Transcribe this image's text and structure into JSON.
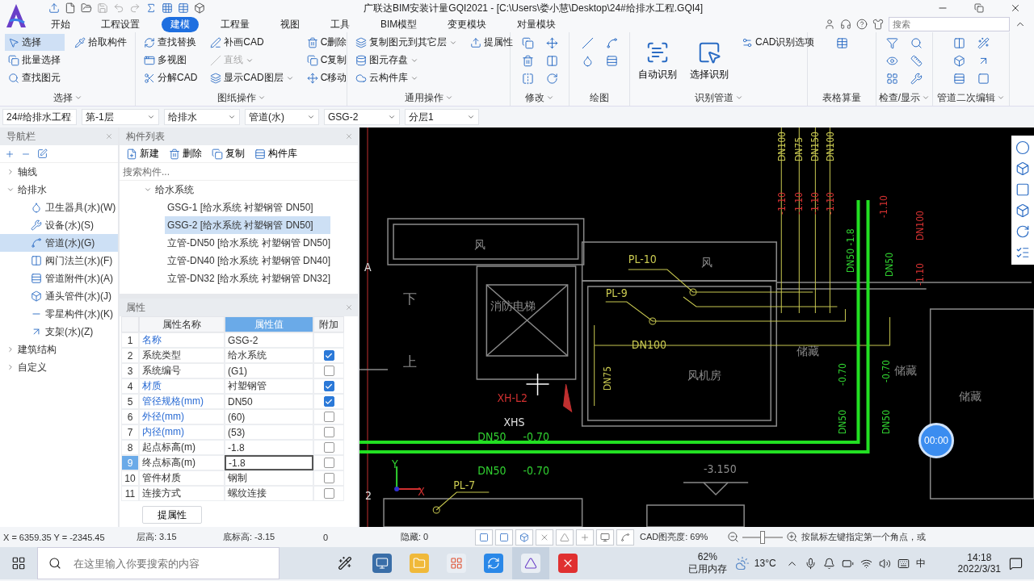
{
  "app": {
    "title": "广联达BIM安装计量GQI2021 - [C:\\Users\\娄小慧\\Desktop\\24#给排水工程.GQI4]"
  },
  "menu_tabs": [
    {
      "label": "开始",
      "selected": false
    },
    {
      "label": "工程设置",
      "selected": false
    },
    {
      "label": "建模",
      "selected": true
    },
    {
      "label": "工程量",
      "selected": false
    },
    {
      "label": "视图",
      "selected": false
    },
    {
      "label": "工具",
      "selected": false
    },
    {
      "label": "BIM模型",
      "selected": false
    },
    {
      "label": "变更模块",
      "selected": false
    },
    {
      "label": "对量模块",
      "selected": false
    }
  ],
  "search": {
    "placeholder": "搜索"
  },
  "ribbon_groups": [
    {
      "title": "选择",
      "dropdown": true,
      "kind": "buttons",
      "items": [
        {
          "label": "选择",
          "kind": "small",
          "active": true
        },
        {
          "label": "批量选择",
          "kind": "small",
          "active": false
        },
        {
          "label": "查找图元",
          "kind": "small",
          "active": false
        },
        {
          "label": "拾取构件",
          "kind": "small",
          "active": false
        }
      ]
    },
    {
      "title": "图纸操作",
      "dropdown": true,
      "kind": "buttons",
      "items": [
        {
          "label": "查找替换",
          "kind": "small",
          "disabled": false
        },
        {
          "label": "多视图",
          "kind": "small",
          "disabled": false
        },
        {
          "label": "分解CAD",
          "kind": "small",
          "disabled": false
        },
        {
          "label": "补画CAD",
          "kind": "small",
          "disabled": false
        },
        {
          "label": "直线",
          "kind": "small",
          "disabled": true,
          "dropdown": true
        },
        {
          "label": "显示CAD图层",
          "kind": "small",
          "disabled": false,
          "dropdown": true
        },
        {
          "label": "C删除",
          "kind": "small",
          "disabled": false
        },
        {
          "label": "C复制",
          "kind": "small",
          "disabled": false
        },
        {
          "label": "C移动",
          "kind": "small",
          "disabled": false
        }
      ]
    },
    {
      "title": "通用操作",
      "dropdown": true,
      "kind": "buttons",
      "items": [
        {
          "label": "复制图元到其它层",
          "kind": "small",
          "dropdown": true
        },
        {
          "label": "图元存盘",
          "kind": "small",
          "dropdown": true
        },
        {
          "label": "云构件库",
          "kind": "small",
          "dropdown": true
        },
        {
          "label": "提属性",
          "kind": "small"
        }
      ]
    },
    {
      "title": "修改",
      "dropdown": true,
      "kind": "icons"
    },
    {
      "title": "绘图",
      "dropdown": false,
      "kind": "icons"
    },
    {
      "title": "识别管道",
      "dropdown": true,
      "kind": "buttons",
      "items": [
        {
          "label": "自动识别",
          "kind": "large"
        },
        {
          "label": "选择识别",
          "kind": "large"
        },
        {
          "label": "CAD识别选项",
          "kind": "small"
        }
      ]
    },
    {
      "title": "表格算量",
      "dropdown": false,
      "kind": "icons"
    },
    {
      "title": "检查/显示",
      "dropdown": true,
      "kind": "icons"
    },
    {
      "title": "管道二次编辑",
      "dropdown": true,
      "kind": "icons"
    }
  ],
  "selectors": [
    "24#给排水工程",
    "第-1层",
    "给排水",
    "管道(水)",
    "GSG-2",
    "分层1"
  ],
  "navigator": {
    "title": "导航栏",
    "tree": [
      {
        "label": "轴线",
        "expanded": false
      },
      {
        "label": "给排水",
        "expanded": true,
        "children": [
          {
            "label": "卫生器具(水)(W)",
            "selected": false
          },
          {
            "label": "设备(水)(S)",
            "selected": false
          },
          {
            "label": "管道(水)(G)",
            "selected": true
          },
          {
            "label": "阀门法兰(水)(F)",
            "selected": false
          },
          {
            "label": "管道附件(水)(A)",
            "selected": false
          },
          {
            "label": "通头管件(水)(J)",
            "selected": false
          },
          {
            "label": "零星构件(水)(K)",
            "selected": false
          },
          {
            "label": "支架(水)(Z)",
            "selected": false
          }
        ]
      },
      {
        "label": "建筑结构",
        "expanded": false
      },
      {
        "label": "自定义",
        "expanded": false
      }
    ]
  },
  "component_list": {
    "title": "构件列表",
    "toolbar": [
      "新建",
      "删除",
      "复制",
      "构件库"
    ],
    "search_placeholder": "搜索构件...",
    "group": {
      "label": "给水系统",
      "expanded": true,
      "children": [
        {
          "label": "GSG-1 [给水系统 衬塑钢管 DN50]",
          "selected": false
        },
        {
          "label": "GSG-2 [给水系统 衬塑钢管 DN50]",
          "selected": true
        },
        {
          "label": "立管-DN50 [给水系统 衬塑钢管 DN50]",
          "selected": false
        },
        {
          "label": "立管-DN40 [给水系统 衬塑钢管 DN40]",
          "selected": false
        },
        {
          "label": "立管-DN32 [给水系统 衬塑钢管 DN32]",
          "selected": false
        }
      ]
    }
  },
  "properties": {
    "title": "属性",
    "columns": [
      "属性名称",
      "属性值",
      "附加"
    ],
    "rows": [
      {
        "index": "1",
        "name": "名称",
        "value": "GSG-2",
        "public": true,
        "selected": false
      },
      {
        "index": "2",
        "name": "系统类型",
        "value": "给水系统",
        "public": false,
        "selected": false,
        "checked": true
      },
      {
        "index": "3",
        "name": "系统编号",
        "value": "(G1)",
        "public": false,
        "selected": false,
        "checked": false
      },
      {
        "index": "4",
        "name": "材质",
        "value": "衬塑钢管",
        "public": true,
        "selected": false,
        "checked": true
      },
      {
        "index": "5",
        "name": "管径规格(mm)",
        "value": "DN50",
        "public": true,
        "selected": false,
        "checked": true
      },
      {
        "index": "6",
        "name": "外径(mm)",
        "value": "(60)",
        "public": true,
        "selected": false,
        "checked": false
      },
      {
        "index": "7",
        "name": "内径(mm)",
        "value": "(53)",
        "public": true,
        "selected": false,
        "checked": false
      },
      {
        "index": "8",
        "name": "起点标高(m)",
        "value": "-1.8",
        "public": false,
        "selected": false,
        "checked": false
      },
      {
        "index": "9",
        "name": "终点标高(m)",
        "value": "-1.8",
        "public": false,
        "selected": true,
        "checked": false
      },
      {
        "index": "10",
        "name": "管件材质",
        "value": "钢制",
        "public": false,
        "selected": false,
        "checked": false
      },
      {
        "index": "11",
        "name": "连接方式",
        "value": "螺纹连接",
        "public": false,
        "selected": false,
        "checked": false
      }
    ],
    "button": "提属性"
  },
  "cad_labels": [
    {
      "text": "DN100",
      "color": "#c8c850"
    },
    {
      "text": "DN75",
      "color": "#c8c850"
    },
    {
      "text": "DN150",
      "color": "#c8c850"
    },
    {
      "text": "DN100",
      "color": "#c8c850"
    },
    {
      "text": "-1.10",
      "color": "#d03030"
    },
    {
      "text": "-1.10",
      "color": "#d03030"
    },
    {
      "text": "-1.10",
      "color": "#d03030"
    },
    {
      "text": "-1.10",
      "color": "#d03030"
    },
    {
      "text": "风",
      "color": "#8a8a8a"
    },
    {
      "text": "PL-10",
      "color": "#c8c850"
    },
    {
      "text": "风",
      "color": "#8a8a8a"
    },
    {
      "text": "PL-9",
      "color": "#c8c850"
    },
    {
      "text": "DN50 -1.8",
      "color": "#30d030"
    },
    {
      "text": "DN50",
      "color": "#30d030"
    },
    {
      "text": "-1.10",
      "color": "#d03030"
    },
    {
      "text": "DN100",
      "color": "#d03030"
    },
    {
      "text": "-1.10",
      "color": "#d03030"
    },
    {
      "text": "消防电梯",
      "color": "#8a8a8a"
    },
    {
      "text": "下",
      "color": "#8a8a8a"
    },
    {
      "text": "上",
      "color": "#8a8a8a"
    },
    {
      "text": "DN100",
      "color": "#c8c850"
    },
    {
      "text": "DN75",
      "color": "#c8c850"
    },
    {
      "text": "风机房",
      "color": "#8a8a8a"
    },
    {
      "text": "储藏",
      "color": "#8a8a8a"
    },
    {
      "text": "-0.70",
      "color": "#30d030"
    },
    {
      "text": "-0.70",
      "color": "#30d030"
    },
    {
      "text": "储藏",
      "color": "#8a8a8a"
    },
    {
      "text": "储藏",
      "color": "#8a8a8a"
    },
    {
      "text": "DN50",
      "color": "#30d030"
    },
    {
      "text": "DN50",
      "color": "#30d030"
    },
    {
      "text": "XH-L2",
      "color": "#d03030"
    },
    {
      "text": "XHS",
      "color": "#e0e0e0"
    },
    {
      "text": "DN50",
      "color": "#30d030"
    },
    {
      "text": "-0.70",
      "color": "#30d030"
    },
    {
      "text": "DN50",
      "color": "#30d030"
    },
    {
      "text": "-0.70",
      "color": "#30d030"
    },
    {
      "text": "-3.150",
      "color": "#8a8a8a"
    },
    {
      "text": "PL-7",
      "color": "#c8c850"
    },
    {
      "text": "A",
      "color": "#e0e0e0"
    },
    {
      "text": "2",
      "color": "#e0e0e0"
    },
    {
      "text": "Y",
      "color": "#30d030"
    },
    {
      "text": "X",
      "color": "#d03030"
    }
  ],
  "timer": "00:00",
  "status_bar": {
    "coords": "X = 6359.35 Y = -2345.45",
    "floor_height": "层高: 3.15",
    "base_elevation": "底标高: -3.15",
    "count": "0",
    "hidden": "隐藏: 0",
    "cad_brightness": "CAD图亮度: 69%",
    "brightness_slider": {
      "level": 0.5
    },
    "hint": "按鼠标左键指定第一个角点，或"
  },
  "taskbar": {
    "search_placeholder": "在这里输入你要搜索的内容",
    "memory_percent": "62%",
    "memory_label": "已用内存",
    "temperature": "13°C",
    "ime": "中",
    "time": "14:18",
    "date": "2022/3/31"
  }
}
